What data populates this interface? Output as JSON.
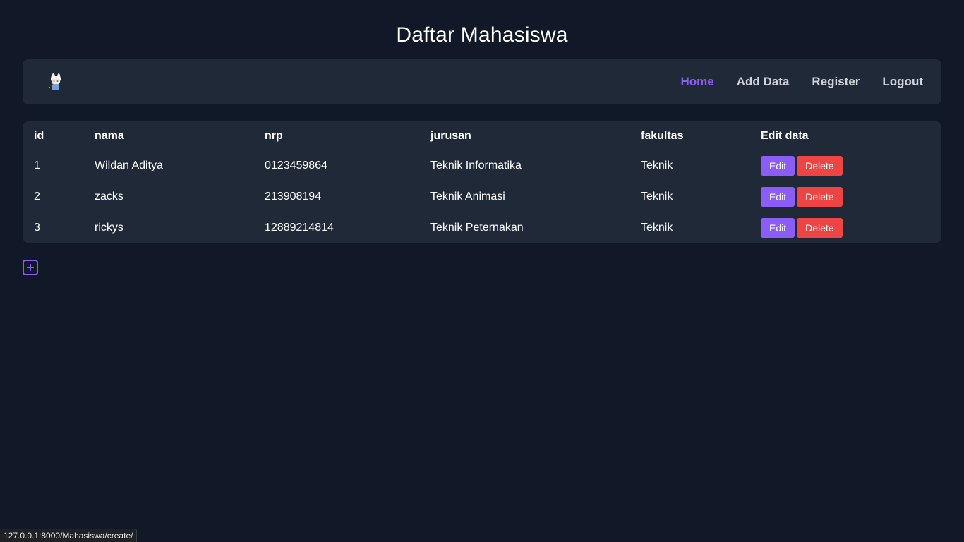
{
  "page": {
    "title": "Daftar Mahasiswa"
  },
  "navbar": {
    "logo_icon": "anime-avatar-logo",
    "links": [
      {
        "label": "Home",
        "active": true
      },
      {
        "label": "Add Data",
        "active": false
      },
      {
        "label": "Register",
        "active": false
      },
      {
        "label": "Logout",
        "active": false
      }
    ]
  },
  "table": {
    "headers": [
      "id",
      "nama",
      "nrp",
      "jurusan",
      "fakultas",
      "Edit data"
    ],
    "rows": [
      {
        "id": "1",
        "nama": "Wildan Aditya",
        "nrp": "0123459864",
        "jurusan": "Teknik Informatika",
        "fakultas": "Teknik"
      },
      {
        "id": "2",
        "nama": "zacks",
        "nrp": "213908194",
        "jurusan": "Teknik Animasi",
        "fakultas": "Teknik"
      },
      {
        "id": "3",
        "nama": "rickys",
        "nrp": "12889214814",
        "jurusan": "Teknik Peternakan",
        "fakultas": "Teknik"
      }
    ],
    "edit_label": "Edit",
    "delete_label": "Delete"
  },
  "add_button": {
    "icon": "plus-square-icon"
  },
  "status_bar": {
    "url": "127.0.0.1:8000/Mahasiswa/create/"
  },
  "colors": {
    "background": "#111827",
    "card": "#1f2937",
    "accent": "#8b5cf6",
    "danger": "#ef4444"
  }
}
